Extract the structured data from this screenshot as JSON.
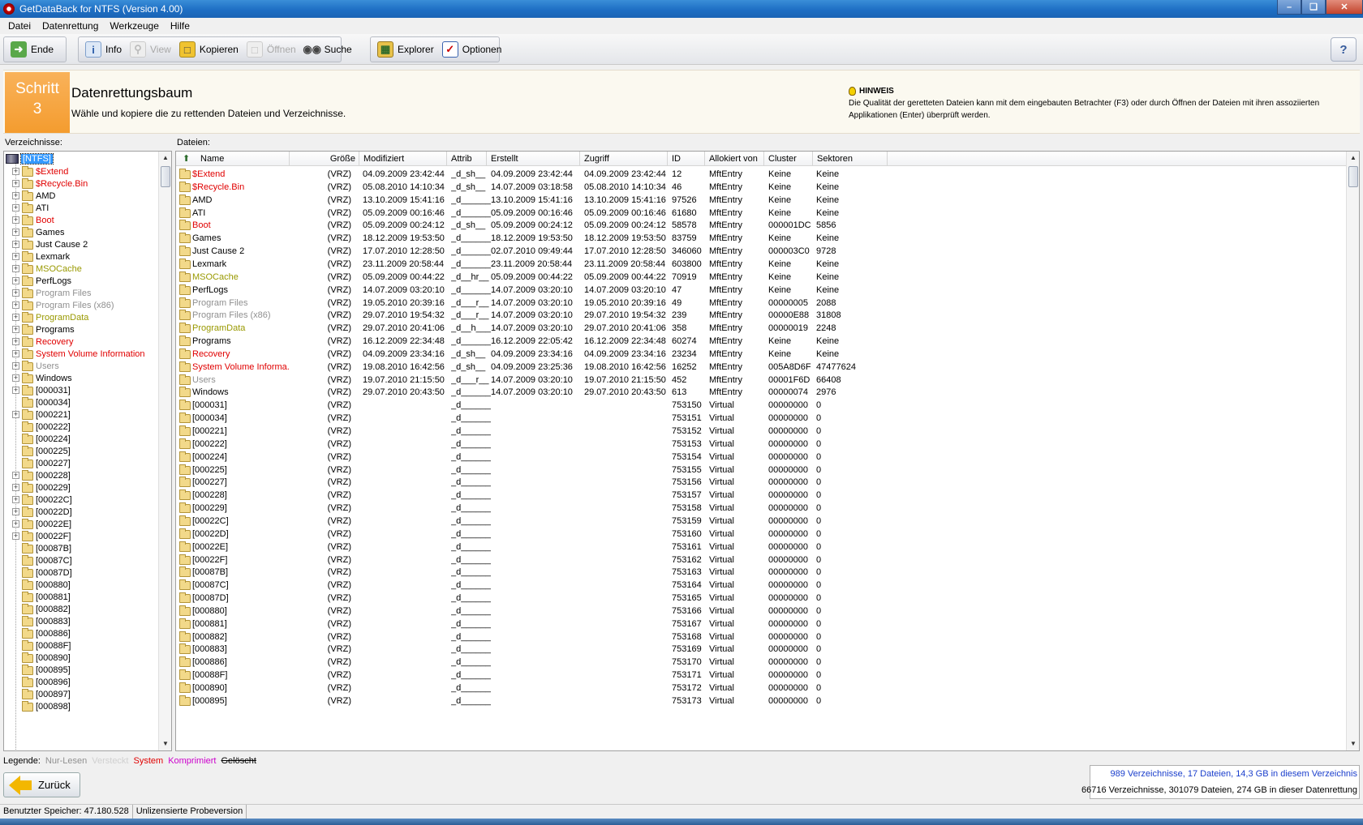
{
  "window": {
    "title": "GetDataBack for NTFS (Version 4.00)"
  },
  "menu": [
    "Datei",
    "Datenrettung",
    "Werkzeuge",
    "Hilfe"
  ],
  "toolbar": {
    "ende": "Ende",
    "info": "Info",
    "view": "View",
    "kopieren": "Kopieren",
    "oeffnen": "Öffnen",
    "suche": "Suche",
    "explorer": "Explorer",
    "optionen": "Optionen"
  },
  "step": {
    "label": "Schritt",
    "number": "3",
    "title": "Datenrettungsbaum",
    "subtitle": "Wähle und kopiere die zu rettenden Dateien und Verzeichnisse.",
    "hint_title": "HINWEIS",
    "hint_text": "Die Qualität der geretteten Dateien kann mit dem eingebauten Betrachter (F3) oder durch Öffnen der Dateien mit ihren assoziierten Applikationen (Enter) überprüft werden."
  },
  "tree": {
    "label": "Verzeichnisse:",
    "root": "[NTFS]",
    "items": [
      {
        "name": "$Extend",
        "color": "red",
        "exp": true
      },
      {
        "name": "$Recycle.Bin",
        "color": "red",
        "exp": true
      },
      {
        "name": "AMD",
        "color": "",
        "exp": true
      },
      {
        "name": "ATI",
        "color": "",
        "exp": true
      },
      {
        "name": "Boot",
        "color": "red",
        "exp": true
      },
      {
        "name": "Games",
        "color": "",
        "exp": true
      },
      {
        "name": "Just Cause 2",
        "color": "",
        "exp": true
      },
      {
        "name": "Lexmark",
        "color": "",
        "exp": true
      },
      {
        "name": "MSOCache",
        "color": "olive",
        "exp": true
      },
      {
        "name": "PerfLogs",
        "color": "",
        "exp": true
      },
      {
        "name": "Program Files",
        "color": "gray",
        "exp": true
      },
      {
        "name": "Program Files (x86)",
        "color": "gray",
        "exp": true
      },
      {
        "name": "ProgramData",
        "color": "olive",
        "exp": true
      },
      {
        "name": "Programs",
        "color": "",
        "exp": true
      },
      {
        "name": "Recovery",
        "color": "red",
        "exp": true
      },
      {
        "name": "System Volume Information",
        "color": "red",
        "exp": true
      },
      {
        "name": "Users",
        "color": "gray",
        "exp": true
      },
      {
        "name": "Windows",
        "color": "",
        "exp": true
      },
      {
        "name": "[000031]",
        "color": "",
        "exp": true
      },
      {
        "name": "[000034]",
        "color": "",
        "exp": false
      },
      {
        "name": "[000221]",
        "color": "",
        "exp": true
      },
      {
        "name": "[000222]",
        "color": "",
        "exp": false
      },
      {
        "name": "[000224]",
        "color": "",
        "exp": false
      },
      {
        "name": "[000225]",
        "color": "",
        "exp": false
      },
      {
        "name": "[000227]",
        "color": "",
        "exp": false
      },
      {
        "name": "[000228]",
        "color": "",
        "exp": true
      },
      {
        "name": "[000229]",
        "color": "",
        "exp": true
      },
      {
        "name": "[00022C]",
        "color": "",
        "exp": true
      },
      {
        "name": "[00022D]",
        "color": "",
        "exp": true
      },
      {
        "name": "[00022E]",
        "color": "",
        "exp": true
      },
      {
        "name": "[00022F]",
        "color": "",
        "exp": true
      },
      {
        "name": "[00087B]",
        "color": "",
        "exp": false
      },
      {
        "name": "[00087C]",
        "color": "",
        "exp": false
      },
      {
        "name": "[00087D]",
        "color": "",
        "exp": false
      },
      {
        "name": "[000880]",
        "color": "",
        "exp": false
      },
      {
        "name": "[000881]",
        "color": "",
        "exp": false
      },
      {
        "name": "[000882]",
        "color": "",
        "exp": false
      },
      {
        "name": "[000883]",
        "color": "",
        "exp": false
      },
      {
        "name": "[000886]",
        "color": "",
        "exp": false
      },
      {
        "name": "[00088F]",
        "color": "",
        "exp": false
      },
      {
        "name": "[000890]",
        "color": "",
        "exp": false
      },
      {
        "name": "[000895]",
        "color": "",
        "exp": false
      },
      {
        "name": "[000896]",
        "color": "",
        "exp": false
      },
      {
        "name": "[000897]",
        "color": "",
        "exp": false
      },
      {
        "name": "[000898]",
        "color": "",
        "exp": false
      }
    ]
  },
  "files": {
    "label": "Dateien:",
    "columns": [
      "Name",
      "Größe",
      "Modifiziert",
      "Attrib",
      "Erstellt",
      "Zugriff",
      "ID",
      "Allokiert von",
      "Cluster",
      "Sektoren"
    ],
    "rows": [
      [
        "$Extend",
        "(VRZ)",
        "04.09.2009 23:42:44",
        "_d_sh__",
        "04.09.2009 23:42:44",
        "04.09.2009 23:42:44",
        "12",
        "MftEntry",
        "Keine",
        "Keine",
        "red"
      ],
      [
        "$Recycle.Bin",
        "(VRZ)",
        "05.08.2010 14:10:34",
        "_d_sh__",
        "14.07.2009 03:18:58",
        "05.08.2010 14:10:34",
        "46",
        "MftEntry",
        "Keine",
        "Keine",
        "red"
      ],
      [
        "AMD",
        "(VRZ)",
        "13.10.2009 15:41:16",
        "_d______",
        "13.10.2009 15:41:16",
        "13.10.2009 15:41:16",
        "97526",
        "MftEntry",
        "Keine",
        "Keine",
        ""
      ],
      [
        "ATI",
        "(VRZ)",
        "05.09.2009 00:16:46",
        "_d______",
        "05.09.2009 00:16:46",
        "05.09.2009 00:16:46",
        "61680",
        "MftEntry",
        "Keine",
        "Keine",
        ""
      ],
      [
        "Boot",
        "(VRZ)",
        "05.09.2009 00:24:12",
        "_d_sh__",
        "05.09.2009 00:24:12",
        "05.09.2009 00:24:12",
        "58578",
        "MftEntry",
        "000001DC",
        "5856",
        "red"
      ],
      [
        "Games",
        "(VRZ)",
        "18.12.2009 19:53:50",
        "_d______",
        "18.12.2009 19:53:50",
        "18.12.2009 19:53:50",
        "83759",
        "MftEntry",
        "Keine",
        "Keine",
        ""
      ],
      [
        "Just Cause 2",
        "(VRZ)",
        "17.07.2010 12:28:50",
        "_d______",
        "02.07.2010 09:49:44",
        "17.07.2010 12:28:50",
        "346060",
        "MftEntry",
        "000003C0",
        "9728",
        ""
      ],
      [
        "Lexmark",
        "(VRZ)",
        "23.11.2009 20:58:44",
        "_d______",
        "23.11.2009 20:58:44",
        "23.11.2009 20:58:44",
        "603800",
        "MftEntry",
        "Keine",
        "Keine",
        ""
      ],
      [
        "MSOCache",
        "(VRZ)",
        "05.09.2009 00:44:22",
        "_d__hr__",
        "05.09.2009 00:44:22",
        "05.09.2009 00:44:22",
        "70919",
        "MftEntry",
        "Keine",
        "Keine",
        "olive"
      ],
      [
        "PerfLogs",
        "(VRZ)",
        "14.07.2009 03:20:10",
        "_d______",
        "14.07.2009 03:20:10",
        "14.07.2009 03:20:10",
        "47",
        "MftEntry",
        "Keine",
        "Keine",
        ""
      ],
      [
        "Program Files",
        "(VRZ)",
        "19.05.2010 20:39:16",
        "_d___r__",
        "14.07.2009 03:20:10",
        "19.05.2010 20:39:16",
        "49",
        "MftEntry",
        "00000005",
        "2088",
        "gray"
      ],
      [
        "Program Files (x86)",
        "(VRZ)",
        "29.07.2010 19:54:32",
        "_d___r__",
        "14.07.2009 03:20:10",
        "29.07.2010 19:54:32",
        "239",
        "MftEntry",
        "00000E88",
        "31808",
        "gray"
      ],
      [
        "ProgramData",
        "(VRZ)",
        "29.07.2010 20:41:06",
        "_d__h___",
        "14.07.2009 03:20:10",
        "29.07.2010 20:41:06",
        "358",
        "MftEntry",
        "00000019",
        "2248",
        "olive"
      ],
      [
        "Programs",
        "(VRZ)",
        "16.12.2009 22:34:48",
        "_d______",
        "16.12.2009 22:05:42",
        "16.12.2009 22:34:48",
        "60274",
        "MftEntry",
        "Keine",
        "Keine",
        ""
      ],
      [
        "Recovery",
        "(VRZ)",
        "04.09.2009 23:34:16",
        "_d_sh__",
        "04.09.2009 23:34:16",
        "04.09.2009 23:34:16",
        "23234",
        "MftEntry",
        "Keine",
        "Keine",
        "red"
      ],
      [
        "System Volume Informa...",
        "(VRZ)",
        "19.08.2010 16:42:56",
        "_d_sh__",
        "04.09.2009 23:25:36",
        "19.08.2010 16:42:56",
        "16252",
        "MftEntry",
        "005A8D6F",
        "47477624",
        "red"
      ],
      [
        "Users",
        "(VRZ)",
        "19.07.2010 21:15:50",
        "_d___r__",
        "14.07.2009 03:20:10",
        "19.07.2010 21:15:50",
        "452",
        "MftEntry",
        "00001F6D",
        "66408",
        "gray"
      ],
      [
        "Windows",
        "(VRZ)",
        "29.07.2010 20:43:50",
        "_d______",
        "14.07.2009 03:20:10",
        "29.07.2010 20:43:50",
        "613",
        "MftEntry",
        "00000074",
        "2976",
        ""
      ],
      [
        "[000031]",
        "(VRZ)",
        "",
        "_d______",
        "",
        "",
        "753150",
        "Virtual",
        "00000000",
        "0",
        ""
      ],
      [
        "[000034]",
        "(VRZ)",
        "",
        "_d______",
        "",
        "",
        "753151",
        "Virtual",
        "00000000",
        "0",
        ""
      ],
      [
        "[000221]",
        "(VRZ)",
        "",
        "_d______",
        "",
        "",
        "753152",
        "Virtual",
        "00000000",
        "0",
        ""
      ],
      [
        "[000222]",
        "(VRZ)",
        "",
        "_d______",
        "",
        "",
        "753153",
        "Virtual",
        "00000000",
        "0",
        ""
      ],
      [
        "[000224]",
        "(VRZ)",
        "",
        "_d______",
        "",
        "",
        "753154",
        "Virtual",
        "00000000",
        "0",
        ""
      ],
      [
        "[000225]",
        "(VRZ)",
        "",
        "_d______",
        "",
        "",
        "753155",
        "Virtual",
        "00000000",
        "0",
        ""
      ],
      [
        "[000227]",
        "(VRZ)",
        "",
        "_d______",
        "",
        "",
        "753156",
        "Virtual",
        "00000000",
        "0",
        ""
      ],
      [
        "[000228]",
        "(VRZ)",
        "",
        "_d______",
        "",
        "",
        "753157",
        "Virtual",
        "00000000",
        "0",
        ""
      ],
      [
        "[000229]",
        "(VRZ)",
        "",
        "_d______",
        "",
        "",
        "753158",
        "Virtual",
        "00000000",
        "0",
        ""
      ],
      [
        "[00022C]",
        "(VRZ)",
        "",
        "_d______",
        "",
        "",
        "753159",
        "Virtual",
        "00000000",
        "0",
        ""
      ],
      [
        "[00022D]",
        "(VRZ)",
        "",
        "_d______",
        "",
        "",
        "753160",
        "Virtual",
        "00000000",
        "0",
        ""
      ],
      [
        "[00022E]",
        "(VRZ)",
        "",
        "_d______",
        "",
        "",
        "753161",
        "Virtual",
        "00000000",
        "0",
        ""
      ],
      [
        "[00022F]",
        "(VRZ)",
        "",
        "_d______",
        "",
        "",
        "753162",
        "Virtual",
        "00000000",
        "0",
        ""
      ],
      [
        "[00087B]",
        "(VRZ)",
        "",
        "_d______",
        "",
        "",
        "753163",
        "Virtual",
        "00000000",
        "0",
        ""
      ],
      [
        "[00087C]",
        "(VRZ)",
        "",
        "_d______",
        "",
        "",
        "753164",
        "Virtual",
        "00000000",
        "0",
        ""
      ],
      [
        "[00087D]",
        "(VRZ)",
        "",
        "_d______",
        "",
        "",
        "753165",
        "Virtual",
        "00000000",
        "0",
        ""
      ],
      [
        "[000880]",
        "(VRZ)",
        "",
        "_d______",
        "",
        "",
        "753166",
        "Virtual",
        "00000000",
        "0",
        ""
      ],
      [
        "[000881]",
        "(VRZ)",
        "",
        "_d______",
        "",
        "",
        "753167",
        "Virtual",
        "00000000",
        "0",
        ""
      ],
      [
        "[000882]",
        "(VRZ)",
        "",
        "_d______",
        "",
        "",
        "753168",
        "Virtual",
        "00000000",
        "0",
        ""
      ],
      [
        "[000883]",
        "(VRZ)",
        "",
        "_d______",
        "",
        "",
        "753169",
        "Virtual",
        "00000000",
        "0",
        ""
      ],
      [
        "[000886]",
        "(VRZ)",
        "",
        "_d______",
        "",
        "",
        "753170",
        "Virtual",
        "00000000",
        "0",
        ""
      ],
      [
        "[00088F]",
        "(VRZ)",
        "",
        "_d______",
        "",
        "",
        "753171",
        "Virtual",
        "00000000",
        "0",
        ""
      ],
      [
        "[000890]",
        "(VRZ)",
        "",
        "_d______",
        "",
        "",
        "753172",
        "Virtual",
        "00000000",
        "0",
        ""
      ],
      [
        "[000895]",
        "(VRZ)",
        "",
        "_d______",
        "",
        "",
        "753173",
        "Virtual",
        "00000000",
        "0",
        ""
      ]
    ]
  },
  "legend": {
    "label": "Legende:",
    "items": [
      {
        "text": "Nur-Lesen",
        "color": "#909090"
      },
      {
        "text": "Versteckt",
        "color": "#d0d0d0"
      },
      {
        "text": "System",
        "color": "#e00000"
      },
      {
        "text": "Komprimiert",
        "color": "#cc00cc"
      },
      {
        "text": "Gelöscht",
        "color": "#000000"
      }
    ]
  },
  "back_button": "Zurück",
  "summary": {
    "line1": "989 Verzeichnisse, 17 Dateien, 14,3 GB in diesem Verzeichnis",
    "line2": "66716 Verzeichnisse, 301079 Dateien, 274 GB in dieser Datenrettung"
  },
  "status": {
    "memory": "Benutzter Speicher: 47.180.528",
    "license": "Unlizensierte Probeversion"
  },
  "colors": {
    "accent": "#f49c2f",
    "system": "#e00000",
    "readonly": "#909090",
    "olive": "#999900"
  }
}
